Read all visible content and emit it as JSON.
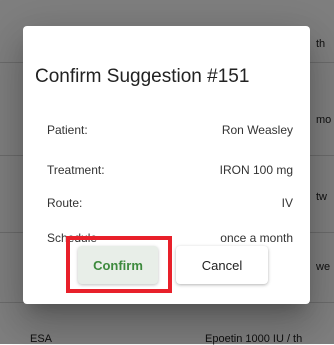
{
  "background": {
    "rows": [
      {
        "text": "th"
      },
      {
        "text": "mo"
      },
      {
        "text": "tw"
      },
      {
        "text": "we"
      },
      {
        "left": "ESA",
        "right": "Epoetin 1000 IU / th"
      }
    ]
  },
  "dialog": {
    "title": "Confirm Suggestion #151",
    "fields": [
      {
        "label": "Patient:",
        "value": "Ron Weasley"
      },
      {
        "label": "Treatment:",
        "value": "IRON 100 mg"
      },
      {
        "label": "Route:",
        "value": "IV"
      },
      {
        "label": "Schedule",
        "value": "once a month"
      }
    ],
    "confirm_label": "Confirm",
    "cancel_label": "Cancel"
  },
  "colors": {
    "highlight": "#e8202a",
    "confirm_text": "#3d8a3d",
    "overlay": "rgba(0,0,0,0.5)"
  }
}
